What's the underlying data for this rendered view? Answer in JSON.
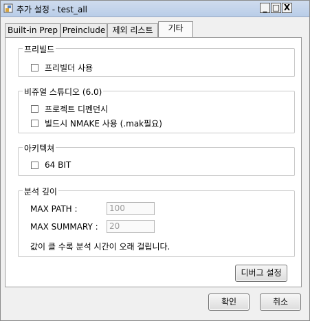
{
  "window": {
    "title": "추가 설정 - test_all",
    "controls": {
      "minimize": "_",
      "maximize": "□",
      "close": "X"
    }
  },
  "tabs": [
    {
      "label": "Built-in Prep"
    },
    {
      "label": "Preinclude"
    },
    {
      "label": "제외 리스트"
    },
    {
      "label": "기타",
      "active": true
    }
  ],
  "groups": {
    "prebuild": {
      "title": "프리빌드",
      "options": [
        "프리빌더 사용"
      ]
    },
    "visual_studio": {
      "title": "비쥬얼 스튜디오 (6.0)",
      "options": [
        "프로젝트 디펜던시",
        "빌드시 NMAKE 사용 (.mak필요)"
      ]
    },
    "architecture": {
      "title": "아키텍쳐",
      "options": [
        "64 BIT"
      ]
    },
    "analysis_depth": {
      "title": "분석 깊이",
      "max_path_label": "MAX PATH :",
      "max_path_value": "100",
      "max_summary_label": "MAX SUMMARY :",
      "max_summary_value": "20",
      "note": "값이 클 수록 분석 시간이 오래 걸립니다."
    }
  },
  "buttons": {
    "debug_settings": "디버그 설정",
    "ok": "확인",
    "cancel": "취소"
  }
}
